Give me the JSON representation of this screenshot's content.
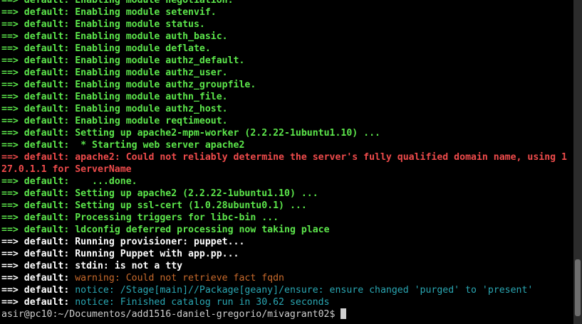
{
  "prompt": "asir@pc10:~/Documentos/add1516-daniel-gregorio/mivagrant02$ ",
  "scroll_position": 0.97,
  "colors": {
    "green": "#5ce64b",
    "red": "#ef4b4b",
    "white": "#ffffff",
    "orange": "#c86a2c",
    "cyan": "#2aa7b3",
    "prompt": "#d0d0d0",
    "bg": "#000000"
  },
  "lines": [
    {
      "arrow": "==>",
      "label": " default:",
      "msg": " Enabling module negotiation.",
      "head": "green",
      "msgc": "green",
      "mb": true
    },
    {
      "arrow": "==>",
      "label": " default:",
      "msg": " Enabling module setenvif.",
      "head": "green",
      "msgc": "green",
      "mb": true
    },
    {
      "arrow": "==>",
      "label": " default:",
      "msg": " Enabling module status.",
      "head": "green",
      "msgc": "green",
      "mb": true
    },
    {
      "arrow": "==>",
      "label": " default:",
      "msg": " Enabling module auth_basic.",
      "head": "green",
      "msgc": "green",
      "mb": true
    },
    {
      "arrow": "==>",
      "label": " default:",
      "msg": " Enabling module deflate.",
      "head": "green",
      "msgc": "green",
      "mb": true
    },
    {
      "arrow": "==>",
      "label": " default:",
      "msg": " Enabling module authz_default.",
      "head": "green",
      "msgc": "green",
      "mb": true
    },
    {
      "arrow": "==>",
      "label": " default:",
      "msg": " Enabling module authz_user.",
      "head": "green",
      "msgc": "green",
      "mb": true
    },
    {
      "arrow": "==>",
      "label": " default:",
      "msg": " Enabling module authz_groupfile.",
      "head": "green",
      "msgc": "green",
      "mb": true
    },
    {
      "arrow": "==>",
      "label": " default:",
      "msg": " Enabling module authn_file.",
      "head": "green",
      "msgc": "green",
      "mb": true
    },
    {
      "arrow": "==>",
      "label": " default:",
      "msg": " Enabling module authz_host.",
      "head": "green",
      "msgc": "green",
      "mb": true
    },
    {
      "arrow": "==>",
      "label": " default:",
      "msg": " Enabling module reqtimeout.",
      "head": "green",
      "msgc": "green",
      "mb": true
    },
    {
      "arrow": "==>",
      "label": " default:",
      "msg": " Setting up apache2-mpm-worker (2.2.22-1ubuntu1.10) ...",
      "head": "green",
      "msgc": "green",
      "mb": true
    },
    {
      "arrow": "==>",
      "label": " default:",
      "msg": "  * Starting web server apache2",
      "head": "green",
      "msgc": "green",
      "mb": true
    },
    {
      "arrow": "==>",
      "label": " default:",
      "msg": " apache2: Could not reliably determine the server's fully qualified domain name, using 1",
      "head": "red",
      "msgc": "red",
      "mb": true
    },
    {
      "arrow": "",
      "label": "",
      "msg": "27.0.1.1 for ServerName",
      "head": "red",
      "msgc": "red",
      "mb": true
    },
    {
      "arrow": "==>",
      "label": " default:",
      "msg": "    ...done.",
      "head": "green",
      "msgc": "green",
      "mb": true
    },
    {
      "arrow": "==>",
      "label": " default:",
      "msg": " Setting up apache2 (2.2.22-1ubuntu1.10) ...",
      "head": "green",
      "msgc": "green",
      "mb": true
    },
    {
      "arrow": "==>",
      "label": " default:",
      "msg": " Setting up ssl-cert (1.0.28ubuntu0.1) ...",
      "head": "green",
      "msgc": "green",
      "mb": true
    },
    {
      "arrow": "==>",
      "label": " default:",
      "msg": " Processing triggers for libc-bin ...",
      "head": "green",
      "msgc": "green",
      "mb": true
    },
    {
      "arrow": "==>",
      "label": " default:",
      "msg": " ldconfig deferred processing now taking place",
      "head": "green",
      "msgc": "green",
      "mb": true
    },
    {
      "arrow": "==>",
      "label": " default:",
      "msg": " Running provisioner: puppet...",
      "head": "white",
      "msgc": "white",
      "mb": true
    },
    {
      "arrow": "==>",
      "label": " default:",
      "msg": " Running Puppet with app.pp...",
      "head": "white",
      "msgc": "white",
      "mb": true
    },
    {
      "arrow": "==>",
      "label": " default:",
      "msg": " stdin: is not a tty",
      "head": "white",
      "msgc": "white",
      "mb": true
    },
    {
      "arrow": "==>",
      "label": " default:",
      "msg": " warning: Could not retrieve fact fqdn",
      "head": "white",
      "msgc": "orange",
      "mb": false
    },
    {
      "arrow": "==>",
      "label": " default:",
      "msg": " notice: /Stage[main]//Package[geany]/ensure: ensure changed 'purged' to 'present'",
      "head": "white",
      "msgc": "cyan",
      "mb": false
    },
    {
      "arrow": "==>",
      "label": " default:",
      "msg": " notice: Finished catalog run in 30.62 seconds",
      "head": "white",
      "msgc": "cyan",
      "mb": false
    }
  ]
}
